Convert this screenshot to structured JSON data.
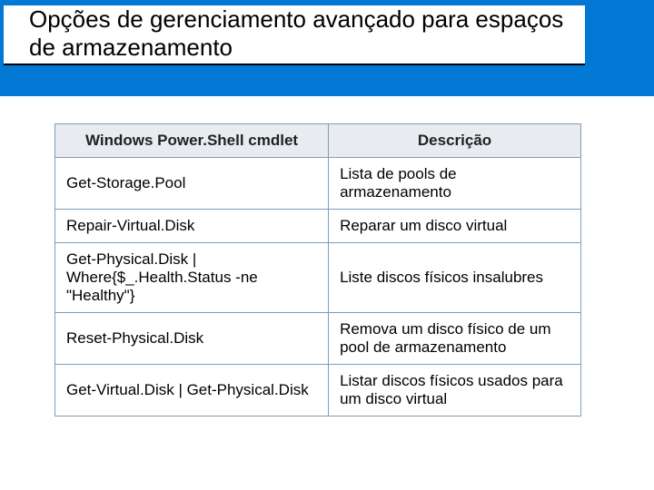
{
  "title": "Opções de gerenciamento avançado para espaços de armazenamento",
  "table": {
    "headers": [
      "Windows Power.Shell cmdlet",
      "Descrição"
    ],
    "rows": [
      {
        "cmd": "Get-Storage.Pool",
        "desc": "Lista de pools de armazenamento"
      },
      {
        "cmd": "Repair-Virtual.Disk",
        "desc": "Reparar um disco virtual"
      },
      {
        "cmd": "Get-Physical.Disk | Where{$_.Health.Status -ne \"Healthy\"}",
        "desc": "Liste discos físicos insalubres"
      },
      {
        "cmd": "Reset-Physical.Disk",
        "desc": "Remova um disco físico de um pool de armazenamento"
      },
      {
        "cmd": "Get-Virtual.Disk | Get-Physical.Disk",
        "desc": "Listar discos físicos usados para um disco virtual"
      }
    ]
  }
}
